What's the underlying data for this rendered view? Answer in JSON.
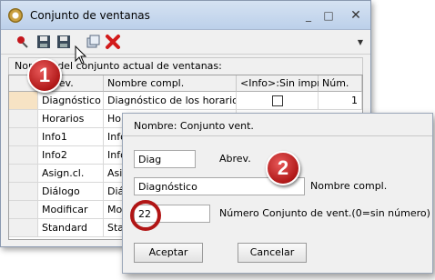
{
  "window": {
    "title": "Conjunto de ventanas",
    "controls": {
      "minimize": "_",
      "maximize": "□",
      "close": "✕"
    },
    "toolbar_icons": [
      "pin-icon",
      "save-icon",
      "save-as-icon",
      "copy-icon",
      "delete-icon"
    ]
  },
  "caption": "Nombre del conjunto actual de ventanas:",
  "grid": {
    "headers": [
      "Abrev.",
      "Nombre compl.",
      "<Info>:Sin impr",
      "Núm."
    ],
    "rows": [
      {
        "abrev": "Diagnóstico",
        "nombre": "Diagnóstico de los horarios",
        "num": "1"
      },
      {
        "abrev": "Horarios",
        "nombre": "Hora"
      },
      {
        "abrev": "Info1",
        "nombre": "Info"
      },
      {
        "abrev": "Info2",
        "nombre": "Info"
      },
      {
        "abrev": "Asign.cl.",
        "nombre": "Asig"
      },
      {
        "abrev": "Diálogo",
        "nombre": "Diálo"
      },
      {
        "abrev": "Modificar",
        "nombre": "Mod"
      },
      {
        "abrev": "Standard",
        "nombre": "Stan"
      }
    ]
  },
  "callouts": {
    "one": "1",
    "two": "2"
  },
  "dialog": {
    "title": "Nombre: Conjunto vent.",
    "abrev_value": "Diag",
    "abrev_label": "Abrev.",
    "nombre_value": "Diagnóstico",
    "nombre_label": "Nombre compl.",
    "numero_value": "22",
    "numero_label": "Número Conjunto de vent.(0=sin número)",
    "accept_label": "Aceptar",
    "cancel_label": "Cancelar"
  },
  "colors": {
    "callout": "#b11515",
    "titlebar": "#c9d9ee",
    "selected_row": "#f7e3c4"
  }
}
